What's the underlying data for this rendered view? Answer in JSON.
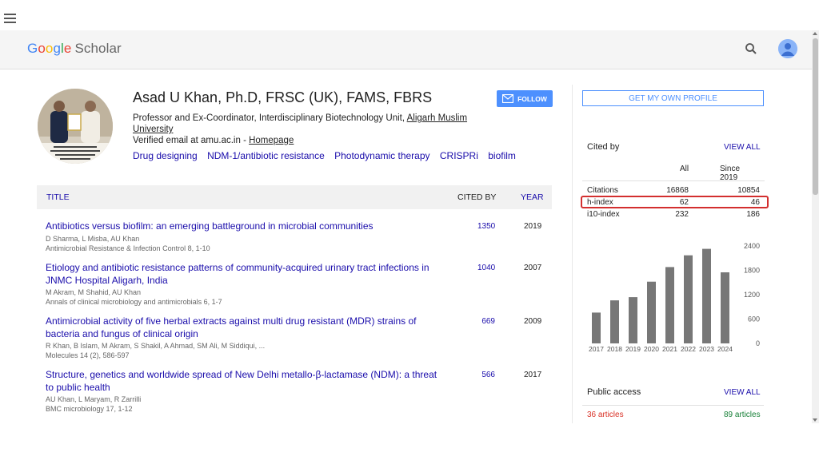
{
  "app": {
    "logo_google": "Google",
    "logo_scholar": "Scholar"
  },
  "profile": {
    "name": "Asad U Khan, Ph.D, FRSC (UK), FAMS, FBRS",
    "affiliation_text": "Professor and Ex-Coordinator, Interdisciplinary Biotechnology Unit, ",
    "affiliation_link": "Aligarh Muslim University",
    "verified": "Verified email at amu.ac.in - ",
    "homepage": "Homepage",
    "interests": [
      "Drug designing",
      "NDM-1/antibiotic resistance",
      "Photodynamic therapy",
      "CRISPRi",
      "biofilm"
    ],
    "follow_label": "FOLLOW"
  },
  "table": {
    "col_title": "TITLE",
    "col_cited": "CITED BY",
    "col_year": "YEAR",
    "rows": [
      {
        "title": "Antibiotics versus biofilm: an emerging battleground in microbial communities",
        "authors": "D Sharma, L Misba, AU Khan",
        "source": "Antimicrobial Resistance & Infection Control 8, 1-10",
        "cites": "1350",
        "year": "2019"
      },
      {
        "title": "Etiology and antibiotic resistance patterns of community-acquired urinary tract infections in JNMC Hospital Aligarh, India",
        "authors": "M Akram, M Shahid, AU Khan",
        "source": "Annals of clinical microbiology and antimicrobials 6, 1-7",
        "cites": "1040",
        "year": "2007"
      },
      {
        "title": "Antimicrobial activity of five herbal extracts against multi drug resistant (MDR) strains of bacteria and fungus of clinical origin",
        "authors": "R Khan, B Islam, M Akram, S Shakil, A Ahmad, SM Ali, M Siddiqui, ...",
        "source": "Molecules 14 (2), 586-597",
        "cites": "669",
        "year": "2009"
      },
      {
        "title": "Structure, genetics and worldwide spread of New Delhi metallo-β-lactamase (NDM): a threat to public health",
        "authors": "AU Khan, L Maryam, R Zarrilli",
        "source": "BMC microbiology 17, 1-12",
        "cites": "566",
        "year": "2017"
      }
    ]
  },
  "sidebar": {
    "get_profile": "GET MY OWN PROFILE",
    "cited_by": "Cited by",
    "view_all": "VIEW ALL",
    "col_all": "All",
    "col_since": "Since 2019",
    "stats": [
      {
        "label": "Citations",
        "all": "16868",
        "since": "10854"
      },
      {
        "label": "h-index",
        "all": "62",
        "since": "46"
      },
      {
        "label": "i10-index",
        "all": "232",
        "since": "186"
      }
    ],
    "public_access": "Public access",
    "pa_view_all": "VIEW ALL",
    "pa_left": "36 articles",
    "pa_right": "89 articles"
  },
  "chart_data": {
    "type": "bar",
    "categories": [
      "2017",
      "2018",
      "2019",
      "2020",
      "2021",
      "2022",
      "2023",
      "2024"
    ],
    "values": [
      760,
      1060,
      1140,
      1520,
      1880,
      2170,
      2330,
      1750
    ],
    "yticks": [
      "0",
      "600",
      "1200",
      "1800",
      "2400"
    ],
    "ylim": [
      0,
      2400
    ],
    "bar_color": "#777777"
  }
}
